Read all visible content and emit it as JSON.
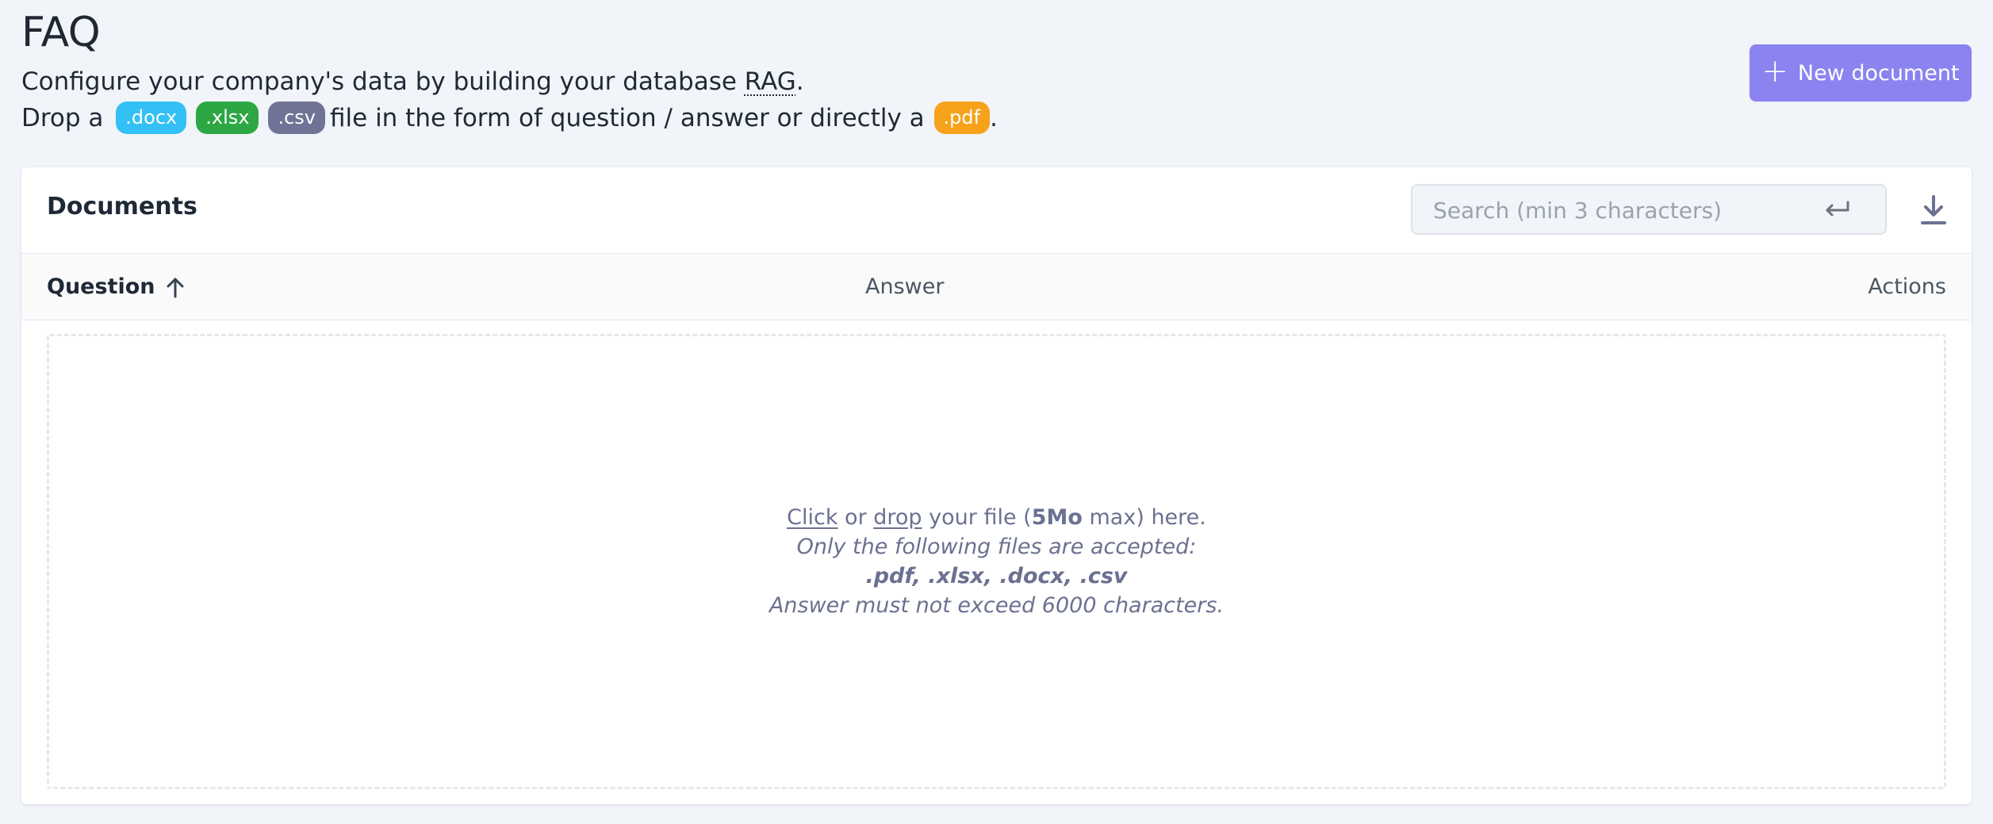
{
  "header": {
    "title": "FAQ",
    "desc_part1": "Configure your company's data by building your database ",
    "desc_abbr": "RAG",
    "desc_part1_end": ".",
    "drop_prefix": "Drop a",
    "drop_middle": "file in the form of question / answer or directly a",
    "drop_end": ".",
    "badges": [
      {
        "label": ".docx",
        "color": "#33c0f5"
      },
      {
        "label": ".xlsx",
        "color": "#2da744"
      },
      {
        "label": ".csv",
        "color": "#6f7496"
      },
      {
        "label": ".pdf",
        "color": "#f7a21b"
      }
    ],
    "new_document_label": "New document",
    "accent_color": "#8b83f0"
  },
  "card": {
    "title": "Documents",
    "search": {
      "placeholder": "Search (min 3 characters)",
      "value": ""
    },
    "icons": {
      "search_submit": "enter-icon",
      "download": "download-icon",
      "sort": "arrow-up-icon"
    },
    "columns": {
      "question": "Question",
      "answer": "Answer",
      "actions": "Actions"
    },
    "dropzone": {
      "click": "Click",
      "or": " or ",
      "drop": "drop",
      "your_file": " your file (",
      "size": "5Mo",
      "max_here": " max) here.",
      "accepted_line": "Only the following files are accepted:",
      "types": ".pdf, .xlsx, .docx, .csv",
      "limit_line": "Answer must not exceed 6000 characters."
    }
  }
}
